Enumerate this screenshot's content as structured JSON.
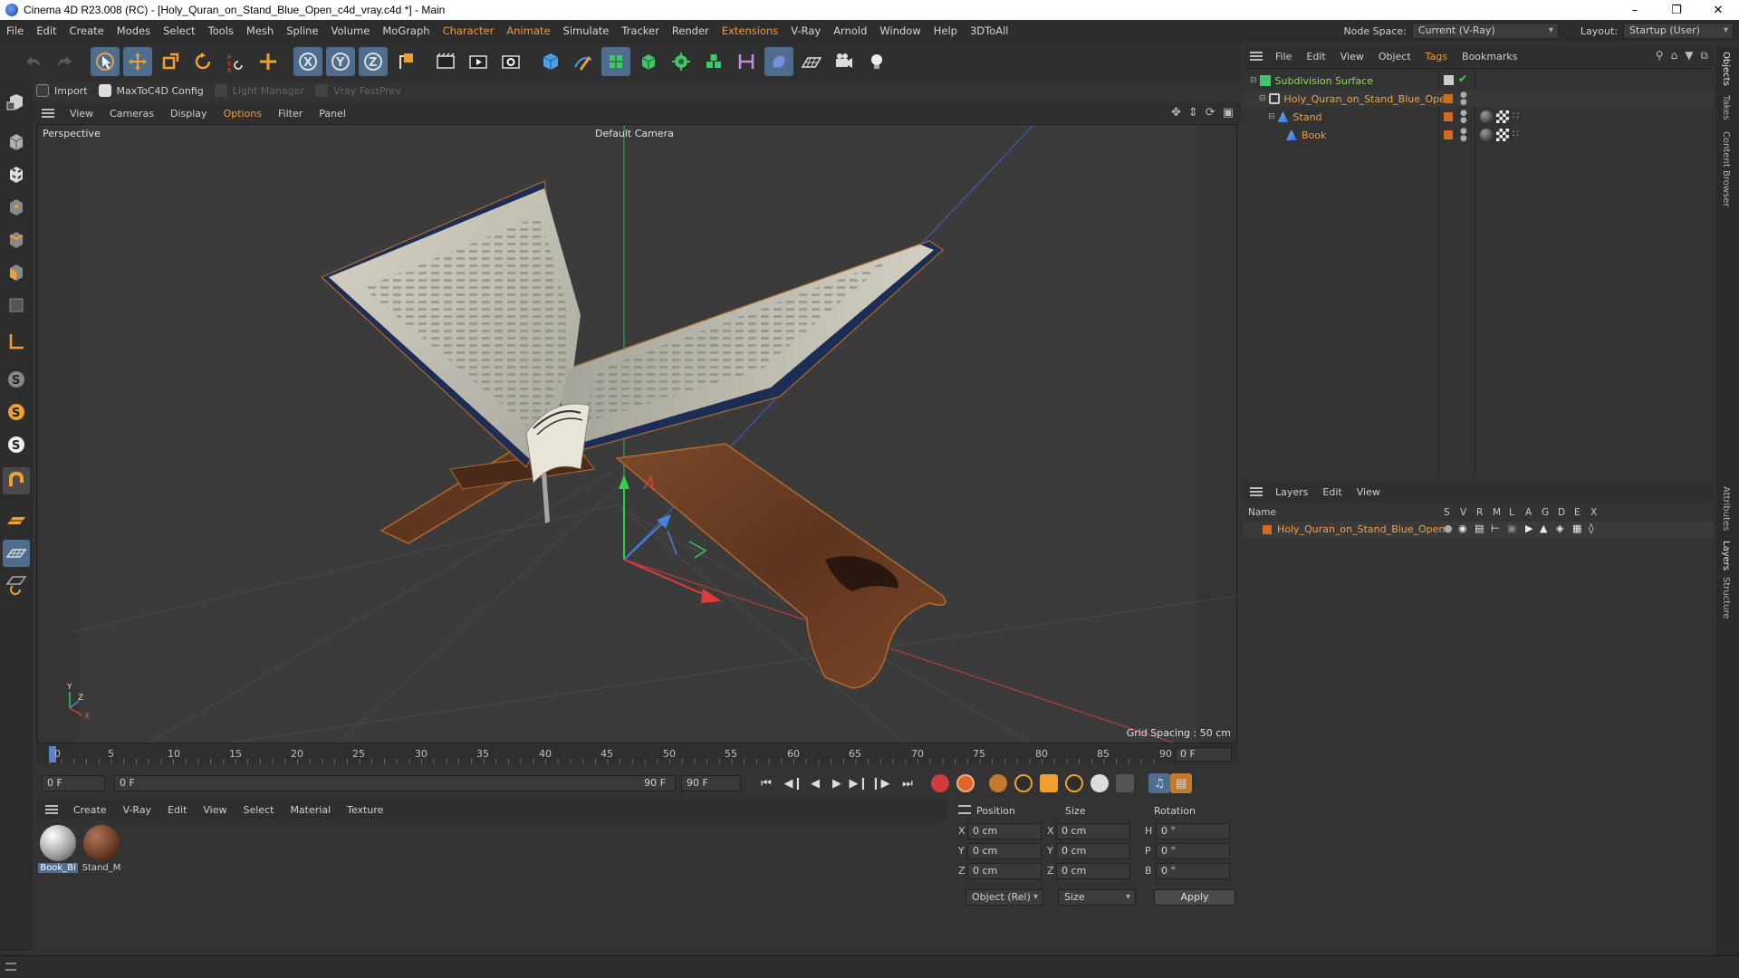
{
  "window": {
    "title": "Cinema 4D R23.008 (RC) - [Holy_Quran_on_Stand_Blue_Open_c4d_vray.c4d *] - Main",
    "controls": [
      "minimize",
      "restore",
      "close"
    ]
  },
  "menubar": {
    "items": [
      "File",
      "Edit",
      "Create",
      "Modes",
      "Select",
      "Tools",
      "Mesh",
      "Spline",
      "Volume",
      "MoGraph",
      "Character",
      "Animate",
      "Simulate",
      "Tracker",
      "Render",
      "Extensions",
      "V-Ray",
      "Arnold",
      "Window",
      "Help",
      "3DToAll"
    ],
    "node_space_label": "Node Space:",
    "node_space_value": "Current (V-Ray)",
    "layout_label": "Layout:",
    "layout_value": "Startup (User)"
  },
  "toolbar": {
    "icons": [
      "undo-icon",
      "redo-icon",
      "select-live-icon",
      "move-icon",
      "scale-icon",
      "rotate-icon",
      "recent-tools-icon",
      "transform-icon",
      "x-axis-lock-icon",
      "y-axis-lock-icon",
      "z-axis-lock-icon",
      "world-coords-icon",
      "render-region-icon",
      "render-view-icon",
      "render-settings-icon",
      "cube-icon",
      "pen-spline-icon",
      "subdivision-icon",
      "extrude-icon",
      "cloner-icon",
      "voronoi-icon",
      "measure-icon",
      "deformer-icon",
      "floor-icon",
      "camera-icon",
      "light-icon"
    ]
  },
  "plugins": {
    "import": "Import",
    "maxtoc4d": "MaxToC4D Config",
    "light_manager": "Light Manager",
    "vray_fastprev": "Vray FastPrev"
  },
  "viewport": {
    "menu": [
      "View",
      "Cameras",
      "Display",
      "Options",
      "Filter",
      "Panel"
    ],
    "projection": "Perspective",
    "camera": "Default Camera",
    "grid_spacing": "Grid Spacing : 50 cm",
    "axis_y": "Y",
    "axis_z": "Z",
    "axis_x": "X"
  },
  "timeline": {
    "ticks": [
      "0",
      "5",
      "10",
      "15",
      "20",
      "25",
      "30",
      "35",
      "40",
      "45",
      "50",
      "55",
      "60",
      "65",
      "70",
      "75",
      "80",
      "85",
      "90"
    ],
    "current_frame": "0 F",
    "start_field": "0 F",
    "range_start": "0 F",
    "range_end": "90 F",
    "end_field": "90 F"
  },
  "material_manager": {
    "menu": [
      "Create",
      "V-Ray",
      "Edit",
      "View",
      "Select",
      "Material",
      "Texture"
    ],
    "materials": [
      {
        "name": "Book_Bl",
        "selected": true,
        "color": "#cfcfcf"
      },
      {
        "name": "Stand_M",
        "selected": false,
        "color": "#6b3a22"
      }
    ]
  },
  "coordinates": {
    "headers": [
      "Position",
      "Size",
      "Rotation"
    ],
    "rows": [
      {
        "axis": "X",
        "pos": "0 cm",
        "size_axis": "X",
        "size": "0 cm",
        "rot_axis": "H",
        "rot": "0 °"
      },
      {
        "axis": "Y",
        "pos": "0 cm",
        "size_axis": "Y",
        "size": "0 cm",
        "rot_axis": "P",
        "rot": "0 °"
      },
      {
        "axis": "Z",
        "pos": "0 cm",
        "size_axis": "Z",
        "size": "0 cm",
        "rot_axis": "B",
        "rot": "0 °"
      }
    ],
    "mode_select": "Object (Rel)",
    "size_select": "Size",
    "apply_label": "Apply"
  },
  "object_manager": {
    "menu": [
      "File",
      "Edit",
      "View",
      "Object",
      "Tags",
      "Bookmarks"
    ],
    "objects": [
      {
        "name": "Subdivision Surface",
        "type": "subdivision",
        "indent": 0
      },
      {
        "name": "Holy_Quran_on_Stand_Blue_Open",
        "type": "null",
        "indent": 1
      },
      {
        "name": "Stand",
        "type": "polygon",
        "indent": 2
      },
      {
        "name": "Book",
        "type": "polygon",
        "indent": 3
      }
    ]
  },
  "layers_manager": {
    "menu": [
      "Layers",
      "Edit",
      "View"
    ],
    "columns": [
      "Name",
      "S",
      "V",
      "R",
      "M",
      "L",
      "A",
      "G",
      "D",
      "E",
      "X"
    ],
    "layers": [
      {
        "name": "Holy_Quran_on_Stand_Blue_Open",
        "color": "#d86a1f"
      }
    ]
  },
  "side_tabs": [
    "Objects",
    "Takes",
    "Content Browser",
    "Attributes",
    "Layers",
    "Structure"
  ],
  "colors": {
    "accent_orange": "#f39a3c",
    "selection_blue": "#4e6f98",
    "object_orange": "#f0a04a",
    "subdivision_green": "#8fdc5a"
  }
}
